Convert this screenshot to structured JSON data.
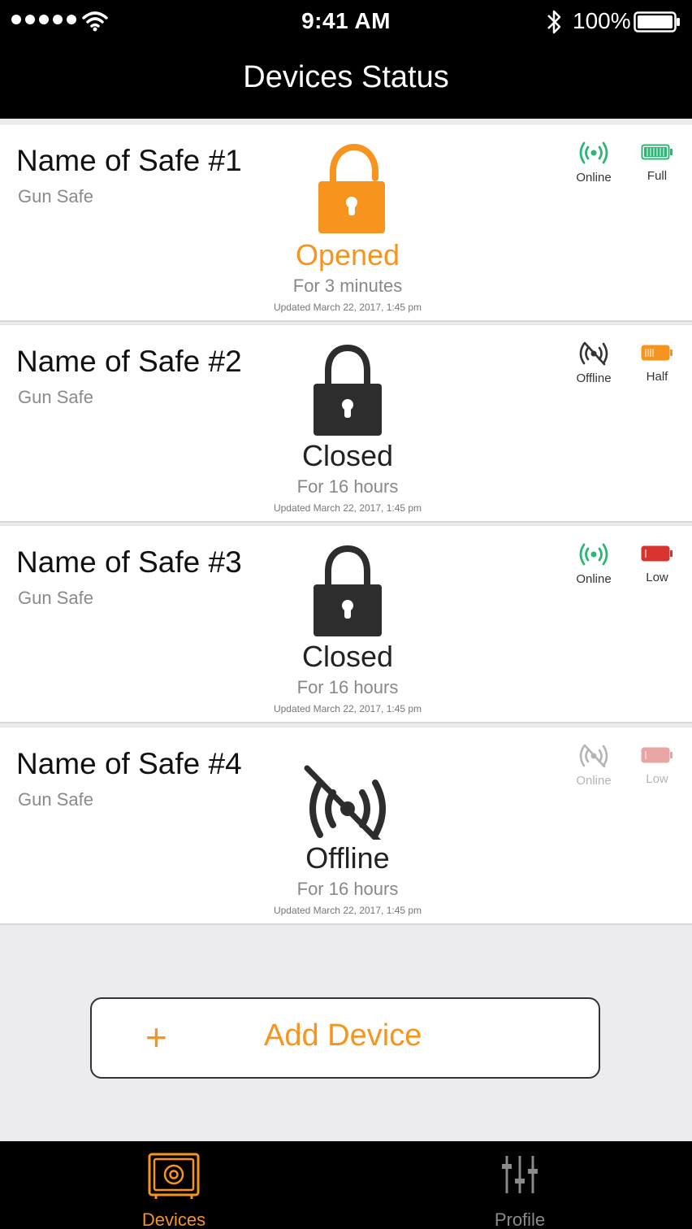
{
  "status_bar": {
    "time": "9:41 AM",
    "battery_percent": "100%",
    "signal_bars": 5,
    "wifi_icon": "wifi-icon",
    "bluetooth_icon": "bluetooth-icon"
  },
  "nav": {
    "title": "Devices Status"
  },
  "colors": {
    "accent": "#f7941d",
    "online": "#2bb673",
    "full": "#2bb673",
    "half": "#f7941d",
    "low": "#d7332f",
    "dark": "#2d2d2d"
  },
  "devices": [
    {
      "name": "Name of Safe #1",
      "type": "Gun Safe",
      "state": "Opened",
      "duration": "For 3 minutes",
      "updated": "Updated March 22, 2017, 1:45 pm",
      "connection": "Online",
      "battery": "Full"
    },
    {
      "name": "Name of Safe #2",
      "type": "Gun Safe",
      "state": "Closed",
      "duration": "For 16 hours",
      "updated": "Updated March 22, 2017, 1:45 pm",
      "connection": "Offline",
      "battery": "Half"
    },
    {
      "name": "Name of Safe #3",
      "type": "Gun Safe",
      "state": "Closed",
      "duration": "For 16 hours",
      "updated": "Updated March 22, 2017, 1:45 pm",
      "connection": "Online",
      "battery": "Low"
    },
    {
      "name": "Name of Safe #4",
      "type": "Gun Safe",
      "state": "Offline",
      "duration": "For 16 hours",
      "updated": "Updated March 22, 2017, 1:45 pm",
      "connection": "Online",
      "battery": "Low"
    }
  ],
  "add_device": {
    "icon": "+",
    "label": "Add Device"
  },
  "tabs": [
    {
      "label": "Devices",
      "icon": "safe-icon",
      "active": true
    },
    {
      "label": "Profile",
      "icon": "sliders-icon",
      "active": false
    }
  ]
}
